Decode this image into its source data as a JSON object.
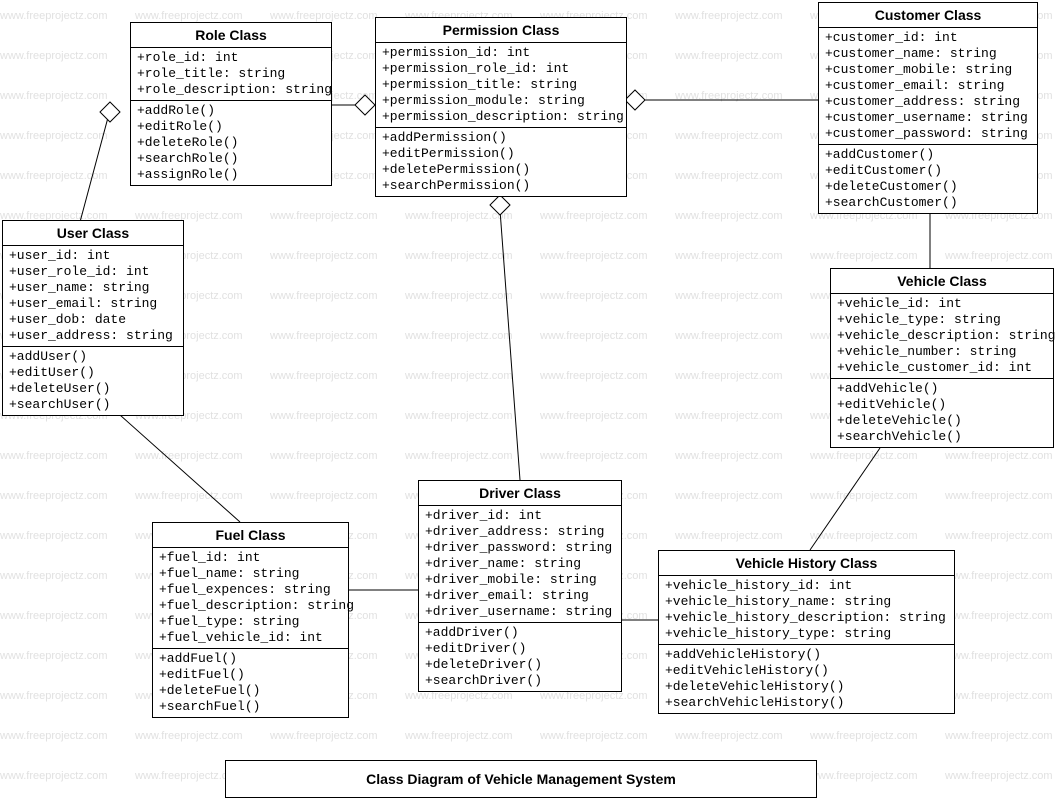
{
  "caption": "Class Diagram of Vehicle Management System",
  "watermark": "www.freeprojectz.com",
  "classes": {
    "role": {
      "title": "Role Class",
      "attrs": [
        "+role_id: int",
        "+role_title: string",
        "+role_description: string"
      ],
      "ops": [
        "+addRole()",
        "+editRole()",
        "+deleteRole()",
        "+searchRole()",
        "+assignRole()"
      ]
    },
    "permission": {
      "title": "Permission Class",
      "attrs": [
        "+permission_id: int",
        "+permission_role_id: int",
        "+permission_title: string",
        "+permission_module: string",
        "+permission_description: string"
      ],
      "ops": [
        "+addPermission()",
        "+editPermission()",
        "+deletePermission()",
        "+searchPermission()"
      ]
    },
    "customer": {
      "title": "Customer Class",
      "attrs": [
        "+customer_id: int",
        "+customer_name: string",
        "+customer_mobile: string",
        "+customer_email: string",
        "+customer_address: string",
        "+customer_username: string",
        "+customer_password: string"
      ],
      "ops": [
        "+addCustomer()",
        "+editCustomer()",
        "+deleteCustomer()",
        "+searchCustomer()"
      ]
    },
    "user": {
      "title": "User Class",
      "attrs": [
        "+user_id: int",
        "+user_role_id: int",
        "+user_name: string",
        "+user_email: string",
        "+user_dob: date",
        "+user_address: string"
      ],
      "ops": [
        "+addUser()",
        "+editUser()",
        "+deleteUser()",
        "+searchUser()"
      ]
    },
    "vehicle": {
      "title": "Vehicle Class",
      "attrs": [
        "+vehicle_id: int",
        "+vehicle_type: string",
        "+vehicle_description: string",
        "+vehicle_number: string",
        "+vehicle_customer_id: int"
      ],
      "ops": [
        "+addVehicle()",
        "+editVehicle()",
        "+deleteVehicle()",
        "+searchVehicle()"
      ]
    },
    "fuel": {
      "title": "Fuel Class",
      "attrs": [
        "+fuel_id: int",
        "+fuel_name: string",
        "+fuel_expences: string",
        "+fuel_description: string",
        "+fuel_type: string",
        "+fuel_vehicle_id: int"
      ],
      "ops": [
        "+addFuel()",
        "+editFuel()",
        "+deleteFuel()",
        "+searchFuel()"
      ]
    },
    "driver": {
      "title": "Driver  Class",
      "attrs": [
        "+driver_id: int",
        "+driver_address: string",
        "+driver_password: string",
        "+driver_name: string",
        "+driver_mobile: string",
        "+driver_email: string",
        "+driver_username: string"
      ],
      "ops": [
        "+addDriver()",
        "+editDriver()",
        "+deleteDriver()",
        "+searchDriver()"
      ]
    },
    "history": {
      "title": "Vehicle History Class",
      "attrs": [
        "+vehicle_history_id: int",
        "+vehicle_history_name: string",
        "+vehicle_history_description: string",
        "+vehicle_history_type: string"
      ],
      "ops": [
        "+addVehicleHistory()",
        "+editVehicleHistory()",
        "+deleteVehicleHistory()",
        "+searchVehicleHistory()"
      ]
    }
  }
}
